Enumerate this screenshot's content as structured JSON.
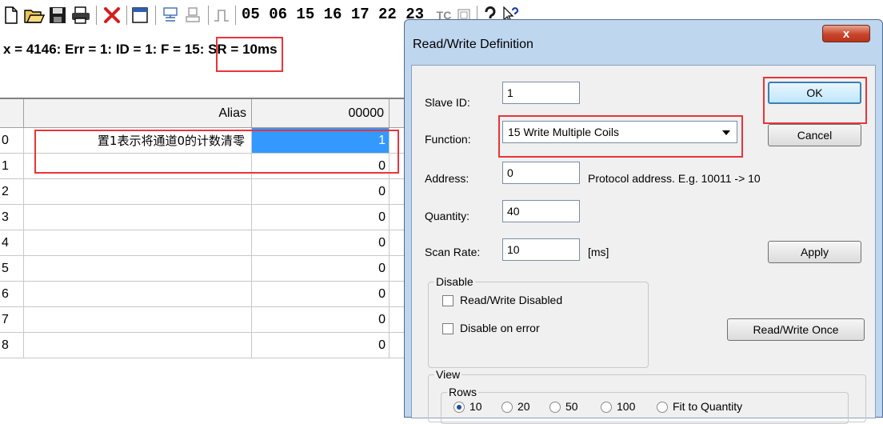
{
  "toolbar": {
    "codes": "05  06  15  16  17  22  23",
    "tc_label": "TC",
    "icons": [
      "new-document-icon",
      "open-folder-icon",
      "save-disk-icon",
      "print-icon",
      "delete-x-icon",
      "window-icon",
      "connect-icon",
      "disconnect-icon",
      "pulse-icon",
      "tc-icon",
      "help-icon",
      "context-help-icon"
    ]
  },
  "status": {
    "text": "x = 4146: Err = 1: ID = 1: F = 15: SR = 10ms"
  },
  "grid": {
    "headers": {
      "alias": "Alias",
      "address": "00000"
    },
    "rows": [
      {
        "index": "0",
        "alias": "置1表示将通道0的计数清零",
        "value": "1"
      },
      {
        "index": "1",
        "alias": "",
        "value": "0"
      },
      {
        "index": "2",
        "alias": "",
        "value": "0"
      },
      {
        "index": "3",
        "alias": "",
        "value": "0"
      },
      {
        "index": "4",
        "alias": "",
        "value": "0"
      },
      {
        "index": "5",
        "alias": "",
        "value": "0"
      },
      {
        "index": "6",
        "alias": "",
        "value": "0"
      },
      {
        "index": "7",
        "alias": "",
        "value": "0"
      },
      {
        "index": "8",
        "alias": "",
        "value": "0"
      }
    ]
  },
  "dialog": {
    "title": "Read/Write Definition",
    "close_label": "x",
    "slave_id_label": "Slave ID:",
    "slave_id_value": "1",
    "function_label": "Function:",
    "function_value": "15 Write Multiple Coils",
    "address_label": "Address:",
    "address_value": "0",
    "address_hint": "Protocol address. E.g. 10011 -> 10",
    "quantity_label": "Quantity:",
    "quantity_value": "40",
    "scan_rate_label": "Scan Rate:",
    "scan_rate_value": "10",
    "scan_rate_unit": "[ms]",
    "ok_label": "OK",
    "cancel_label": "Cancel",
    "apply_label": "Apply",
    "disable_group": "Disable",
    "rw_disabled_label": "Read/Write Disabled",
    "disable_on_error_label": "Disable on error",
    "rw_once_label": "Read/Write Once",
    "view_group": "View",
    "rows_group": "Rows",
    "row_options": [
      "10",
      "20",
      "50",
      "100",
      "Fit to Quantity"
    ],
    "selected_rows": "10"
  },
  "colors": {
    "highlight": "#e8343a",
    "selection": "#3399ff",
    "dialog_frame": "#bfd6ef"
  }
}
